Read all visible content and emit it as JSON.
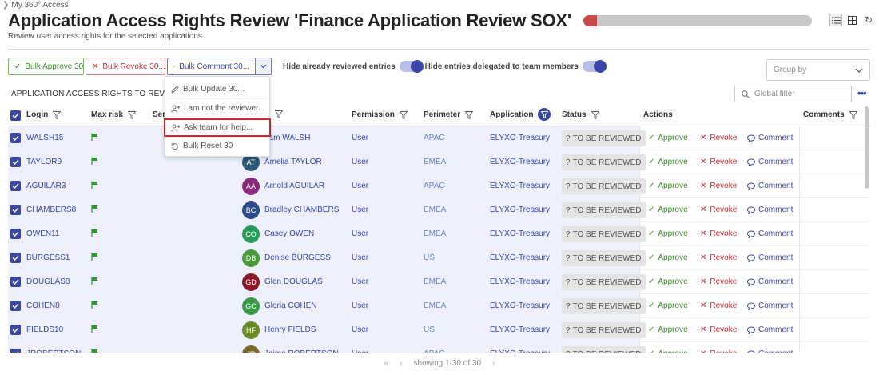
{
  "breadcrumb": "My 360° Access",
  "title": "Application Access Rights Review 'Finance Application Review SOX'",
  "subtitle": "Review user access rights for the selected applications",
  "progress": {
    "value": 0.06,
    "color": "#c94a4a"
  },
  "toolbar": {
    "bulk_approve": "Bulk Approve 30",
    "bulk_revoke": "Bulk Revoke 30...",
    "bulk_comment": "Bulk Comment 30...",
    "hide_reviewed": "Hide already reviewed entries",
    "hide_delegated": "Hide entries delegated to team members"
  },
  "group_by_placeholder": "Group by",
  "section_label": "APPLICATION ACCESS RIGHTS TO REVIEW",
  "global_filter_placeholder": "Global filter",
  "columns": {
    "login": "Login",
    "max_risk": "Max risk",
    "ser": "Ser",
    "permission": "Permission",
    "perimeter": "Perimeter",
    "application": "Application",
    "status": "Status",
    "actions": "Actions",
    "comments": "Comments"
  },
  "dropdown": {
    "items": [
      "Bulk Update 30...",
      "I am not the reviewer...",
      "Ask team for help...",
      "Bulk Reset 30"
    ]
  },
  "rows": [
    {
      "login": "WALSH15",
      "initials": "",
      "name": "dam WALSH",
      "avatar_color": "#7a4a8a",
      "permission": "User",
      "perimeter": "APAC",
      "application": "ELYXO-Treasury",
      "status": "TO BE REVIEWED"
    },
    {
      "login": "TAYLOR9",
      "initials": "AT",
      "name": "Amelia TAYLOR",
      "avatar_color": "#2e5a7a",
      "permission": "User",
      "perimeter": "EMEA",
      "application": "ELYXO-Treasury",
      "status": "TO BE REVIEWED"
    },
    {
      "login": "AGUILAR3",
      "initials": "AA",
      "name": "Arnold AGUILAR",
      "avatar_color": "#8a2a7a",
      "permission": "User",
      "perimeter": "APAC",
      "application": "ELYXO-Treasury",
      "status": "TO BE REVIEWED"
    },
    {
      "login": "CHAMBERS8",
      "initials": "BC",
      "name": "Bradley CHAMBERS",
      "avatar_color": "#2a4a8a",
      "permission": "User",
      "perimeter": "EMEA",
      "application": "ELYXO-Treasury",
      "status": "TO BE REVIEWED"
    },
    {
      "login": "OWEN11",
      "initials": "CO",
      "name": "Casey OWEN",
      "avatar_color": "#2a9a5a",
      "permission": "User",
      "perimeter": "EMEA",
      "application": "ELYXO-Treasury",
      "status": "TO BE REVIEWED"
    },
    {
      "login": "BURGESS1",
      "initials": "DB",
      "name": "Denise BURGESS",
      "avatar_color": "#4a9a3a",
      "permission": "User",
      "perimeter": "US",
      "application": "ELYXO-Treasury",
      "status": "TO BE REVIEWED"
    },
    {
      "login": "DOUGLAS8",
      "initials": "GD",
      "name": "Glen DOUGLAS",
      "avatar_color": "#8a1a2a",
      "permission": "User",
      "perimeter": "EMEA",
      "application": "ELYXO-Treasury",
      "status": "TO BE REVIEWED"
    },
    {
      "login": "COHEN8",
      "initials": "GC",
      "name": "Gloria COHEN",
      "avatar_color": "#3a9a4a",
      "permission": "User",
      "perimeter": "EMEA",
      "application": "ELYXO-Treasury",
      "status": "TO BE REVIEWED"
    },
    {
      "login": "FIELDS10",
      "initials": "HF",
      "name": "Henry FIELDS",
      "avatar_color": "#6a8a2a",
      "permission": "User",
      "perimeter": "US",
      "application": "ELYXO-Treasury",
      "status": "TO BE REVIEWED"
    },
    {
      "login": "JROBERTSON",
      "initials": "JR",
      "name": "Jaime ROBERTSON",
      "avatar_color": "#7a6a2a",
      "permission": "User",
      "perimeter": "APAC",
      "application": "ELYXO-Treasury",
      "status": "TO BE REVIEWED"
    }
  ],
  "actions": {
    "approve": "Approve",
    "revoke": "Revoke",
    "comment": "Comment"
  },
  "pagination": {
    "text": "showing 1-30 of 30"
  },
  "colors": {
    "accent": "#3a47a8",
    "approve": "#3a8a2a",
    "revoke": "#c43030",
    "highlight": "#d0262e"
  }
}
